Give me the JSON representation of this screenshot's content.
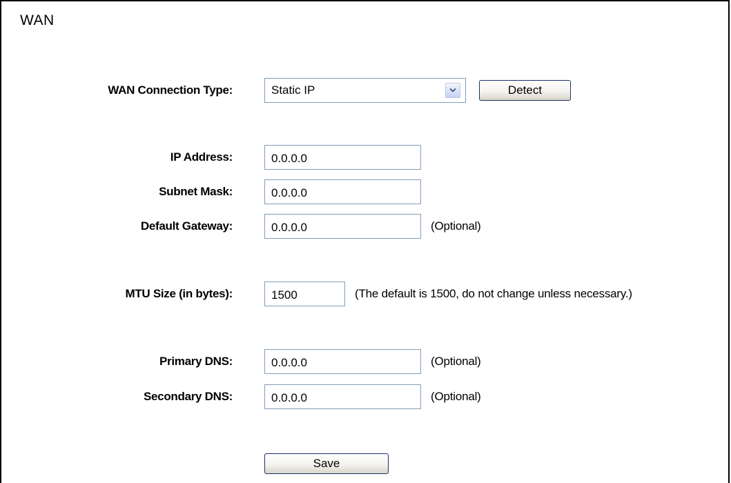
{
  "page": {
    "title": "WAN"
  },
  "connection": {
    "label": "WAN Connection Type:",
    "selected": "Static IP",
    "detect_label": "Detect"
  },
  "ip_address": {
    "label": "IP Address:",
    "value": "0.0.0.0"
  },
  "subnet_mask": {
    "label": "Subnet Mask:",
    "value": "0.0.0.0"
  },
  "default_gateway": {
    "label": "Default Gateway:",
    "value": "0.0.0.0",
    "hint": "(Optional)"
  },
  "mtu": {
    "label": "MTU Size (in bytes):",
    "value": "1500",
    "hint": "(The default is 1500, do not change unless necessary.)"
  },
  "primary_dns": {
    "label": "Primary DNS:",
    "value": "0.0.0.0",
    "hint": "(Optional)"
  },
  "secondary_dns": {
    "label": "Secondary DNS:",
    "value": "0.0.0.0",
    "hint": "(Optional)"
  },
  "actions": {
    "save_label": "Save"
  },
  "icons": {
    "select_arrow": "chevron-down-icon"
  },
  "colors": {
    "input_border": "#7f9db9",
    "button_border": "#1c2e6b",
    "arrow_color": "#4d6185"
  }
}
